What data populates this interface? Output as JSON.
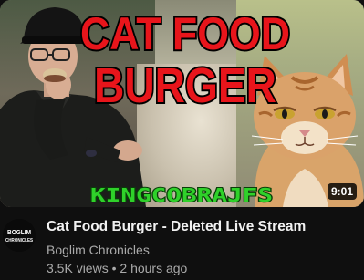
{
  "thumbnail": {
    "title_line1": "CAT FOOD",
    "title_line2": "BURGER",
    "watermark": "KINGCOBRAJFS",
    "duration": "9:01",
    "title_color": "#e8151b",
    "title_outline": "#000000",
    "watermark_color": "#2fd12a"
  },
  "channel_avatar": {
    "line1": "BOGLIM",
    "line2": "CHRONICLES"
  },
  "video": {
    "title": "Cat Food Burger - Deleted Live Stream",
    "channel": "Boglim Chronicles",
    "views": "3.5K views",
    "separator": "•",
    "age": "2 hours ago"
  }
}
